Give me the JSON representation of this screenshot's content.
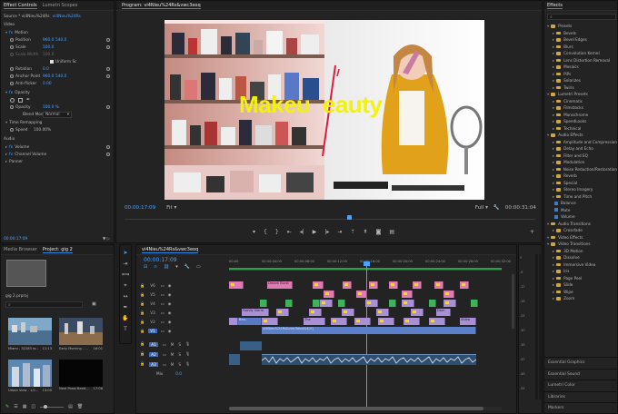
{
  "effect_controls": {
    "tabs": [
      "Effect Controls",
      "Lumetri Scopes"
    ],
    "source_label": "Source * vi4Nieu%24Rs",
    "sequence_label": "vi4Nieu%24Rs",
    "video_header": "Video",
    "motion": {
      "label": "Motion",
      "position_label": "Position",
      "position_x": "960.0",
      "position_y": "540.0",
      "scale_label": "Scale",
      "scale_value": "100.0",
      "scale_width_label": "Scale Width",
      "scale_width_value": "100.0",
      "uniform_scale_label": "Uniform Sc",
      "rotation_label": "Rotation",
      "rotation_value": "0.0",
      "anchor_label": "Anchor Point",
      "anchor_x": "960.0",
      "anchor_y": "540.0",
      "antiflicker_label": "Anti-flicker",
      "antiflicker_value": "0.00"
    },
    "opacity": {
      "label": "Opacity",
      "opacity_label": "Opacity",
      "opacity_value": "100.0 %",
      "blend_label": "Blend Mode",
      "blend_value": "Normal"
    },
    "time_remap": {
      "label": "Time Remapping",
      "speed_label": "Speed",
      "speed_value": "100.00%"
    },
    "audio_header": "Audio",
    "volume_label": "Volume",
    "channel_volume_label": "Channel Volume",
    "panner_label": "Panner",
    "timecode": "00:00:17:09"
  },
  "program": {
    "title": "Program: vi4Nieu%24Rs&vwc3eoq",
    "overlay_text": "Makeu  eauty",
    "timecode_left": "00:00:17:09",
    "fit_label": "Fit",
    "full_label": "Full",
    "timecode_right": "00:00:31:04",
    "colors": {
      "accent": "#2d8ceb",
      "overlay_text": "#f2f20a"
    }
  },
  "project": {
    "tabs": [
      "Media Browser",
      "Project: gig 2"
    ],
    "bin_label": "gig 2.prproj",
    "search_placeholder": "",
    "thumbs": [
      {
        "name": "Miami - 32283 ro...",
        "duration": "11:13"
      },
      {
        "name": "Early Morning - ...",
        "duration": "16:01"
      },
      {
        "name": "Urban View - 1/2...",
        "duration": "13:00"
      },
      {
        "name": "Next Posst Beed...",
        "duration": "17:08"
      }
    ]
  },
  "timeline": {
    "tab": "vi4Nieu%24Rs&vwc3eoq",
    "timecode": "00:00:17:09",
    "ruler": [
      "00:00",
      "00:00:04:00",
      "00:00:08:00",
      "00:00:12:00",
      "00:00:16:00",
      "00:00:20:00",
      "00:00:24:00",
      "00:00:28:00",
      "00:00:32:00"
    ],
    "video_tracks": [
      "V6",
      "V5",
      "V4",
      "V3",
      "V2",
      "V1"
    ],
    "audio_tracks": [
      "A1",
      "A2",
      "A3"
    ],
    "master_label": "Mix",
    "master_value": "0.0",
    "clip_labels": {
      "dream_burst": "Dream Burst",
      "family_vierm": "Family Vierm",
      "beauty": "Bea..",
      "the": "The",
      "video": "Video",
      "dam": "Dam",
      "v1_long": "vi4Nieu%24Rs&vwc3eoq%4[V]"
    }
  },
  "effects": {
    "title": "Effects",
    "items": [
      {
        "label": "Presets",
        "kind": "folder",
        "depth": 0
      },
      {
        "label": "Bevels",
        "kind": "folder",
        "depth": 1
      },
      {
        "label": "Bevel Edges",
        "kind": "folder",
        "depth": 1
      },
      {
        "label": "Blurs",
        "kind": "folder",
        "depth": 1
      },
      {
        "label": "Convolution Kernel",
        "kind": "folder",
        "depth": 1
      },
      {
        "label": "Lens Distortion Removal",
        "kind": "folder",
        "depth": 1
      },
      {
        "label": "Mosaics",
        "kind": "folder",
        "depth": 1
      },
      {
        "label": "PiPs",
        "kind": "folder",
        "depth": 1
      },
      {
        "label": "Solarizes",
        "kind": "folder",
        "depth": 1
      },
      {
        "label": "Twirls",
        "kind": "folder",
        "depth": 1
      },
      {
        "label": "Lumetri Presets",
        "kind": "folder",
        "depth": 0
      },
      {
        "label": "Cinematic",
        "kind": "folder",
        "depth": 1
      },
      {
        "label": "Filmstocks",
        "kind": "folder",
        "depth": 1
      },
      {
        "label": "Monochrome",
        "kind": "folder",
        "depth": 1
      },
      {
        "label": "SpeedLooks",
        "kind": "folder",
        "depth": 1
      },
      {
        "label": "Technical",
        "kind": "folder",
        "depth": 1
      },
      {
        "label": "Audio Effects",
        "kind": "folder",
        "depth": 0
      },
      {
        "label": "Amplitude and Compression",
        "kind": "folder",
        "depth": 1
      },
      {
        "label": "Delay and Echo",
        "kind": "folder",
        "depth": 1
      },
      {
        "label": "Filter and EQ",
        "kind": "folder",
        "depth": 1
      },
      {
        "label": "Modulation",
        "kind": "folder",
        "depth": 1
      },
      {
        "label": "Noise Reduction/Restoration",
        "kind": "folder",
        "depth": 1
      },
      {
        "label": "Reverb",
        "kind": "folder",
        "depth": 1
      },
      {
        "label": "Special",
        "kind": "folder",
        "depth": 1
      },
      {
        "label": "Stereo Imagery",
        "kind": "folder",
        "depth": 1
      },
      {
        "label": "Time and Pitch",
        "kind": "folder",
        "depth": 1
      },
      {
        "label": "Balance",
        "kind": "fx",
        "depth": 1
      },
      {
        "label": "Mute",
        "kind": "fx",
        "depth": 1
      },
      {
        "label": "Volume",
        "kind": "fx",
        "depth": 1
      },
      {
        "label": "Audio Transitions",
        "kind": "folder",
        "depth": 0
      },
      {
        "label": "Crossfade",
        "kind": "folder",
        "depth": 1
      },
      {
        "label": "Video Effects",
        "kind": "folder",
        "depth": 0
      },
      {
        "label": "Video Transitions",
        "kind": "folder",
        "depth": 0
      },
      {
        "label": "3D Motion",
        "kind": "folder",
        "depth": 1
      },
      {
        "label": "Dissolve",
        "kind": "folder",
        "depth": 1
      },
      {
        "label": "Immersive Video",
        "kind": "folder",
        "depth": 1
      },
      {
        "label": "Iris",
        "kind": "folder",
        "depth": 1
      },
      {
        "label": "Page Peel",
        "kind": "folder",
        "depth": 1
      },
      {
        "label": "Slide",
        "kind": "folder",
        "depth": 1
      },
      {
        "label": "Wipe",
        "kind": "folder",
        "depth": 1
      },
      {
        "label": "Zoom",
        "kind": "folder",
        "depth": 1
      }
    ],
    "bottom_panels": [
      "Essential Graphics",
      "Essential Sound",
      "Lumetri Color",
      "Libraries",
      "Markers"
    ]
  },
  "meter": {
    "ticks": [
      "0",
      "-6",
      "-12",
      "-18",
      "-24",
      "-30",
      "-36",
      "-42",
      "-48",
      "-54"
    ]
  }
}
